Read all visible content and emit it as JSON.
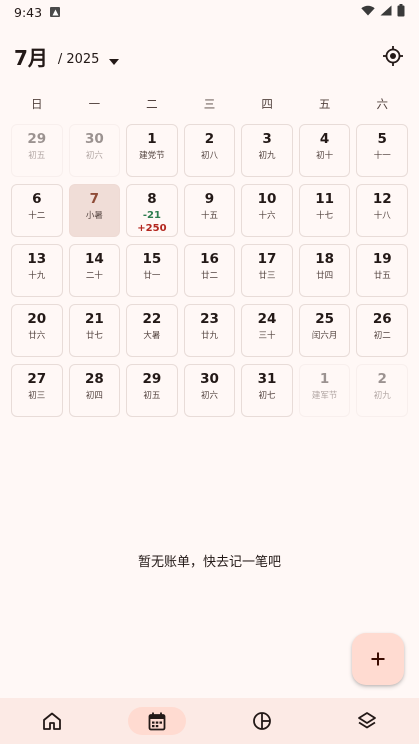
{
  "status_bar": {
    "time": "9:43"
  },
  "header": {
    "month": "7月",
    "separator": "/",
    "year": "2025"
  },
  "weekdays": [
    "日",
    "一",
    "二",
    "三",
    "四",
    "五",
    "六"
  ],
  "calendar": [
    {
      "day": "29",
      "sub": "初五",
      "outside": true
    },
    {
      "day": "30",
      "sub": "初六",
      "outside": true
    },
    {
      "day": "1",
      "sub": "建党节"
    },
    {
      "day": "2",
      "sub": "初八"
    },
    {
      "day": "3",
      "sub": "初九"
    },
    {
      "day": "4",
      "sub": "初十"
    },
    {
      "day": "5",
      "sub": "十一"
    },
    {
      "day": "6",
      "sub": "十二"
    },
    {
      "day": "7",
      "sub": "小暑",
      "today": true
    },
    {
      "day": "8",
      "expense": "-21",
      "income": "+250"
    },
    {
      "day": "9",
      "sub": "十五"
    },
    {
      "day": "10",
      "sub": "十六"
    },
    {
      "day": "11",
      "sub": "十七"
    },
    {
      "day": "12",
      "sub": "十八"
    },
    {
      "day": "13",
      "sub": "十九"
    },
    {
      "day": "14",
      "sub": "二十"
    },
    {
      "day": "15",
      "sub": "廿一"
    },
    {
      "day": "16",
      "sub": "廿二"
    },
    {
      "day": "17",
      "sub": "廿三"
    },
    {
      "day": "18",
      "sub": "廿四"
    },
    {
      "day": "19",
      "sub": "廿五"
    },
    {
      "day": "20",
      "sub": "廿六"
    },
    {
      "day": "21",
      "sub": "廿七"
    },
    {
      "day": "22",
      "sub": "大暑"
    },
    {
      "day": "23",
      "sub": "廿九"
    },
    {
      "day": "24",
      "sub": "三十"
    },
    {
      "day": "25",
      "sub": "闰六月"
    },
    {
      "day": "26",
      "sub": "初二"
    },
    {
      "day": "27",
      "sub": "初三"
    },
    {
      "day": "28",
      "sub": "初四"
    },
    {
      "day": "29",
      "sub": "初五"
    },
    {
      "day": "30",
      "sub": "初六"
    },
    {
      "day": "31",
      "sub": "初七"
    },
    {
      "day": "1",
      "sub": "建军节",
      "outside": true
    },
    {
      "day": "2",
      "sub": "初九",
      "outside": true
    }
  ],
  "empty_message": "暂无账单，快去记一笔吧",
  "bottom_nav": [
    {
      "icon": "home-icon",
      "active": false
    },
    {
      "icon": "calendar-icon",
      "active": true
    },
    {
      "icon": "chart-icon",
      "active": false
    },
    {
      "icon": "layers-icon",
      "active": false
    }
  ],
  "colors": {
    "background": "#fff8f6",
    "today_bg": "#f0ddd7",
    "expense": "#2e7d4f",
    "income": "#b3261e",
    "fab_bg": "#ffdbd1",
    "nav_bg": "#fceae5"
  }
}
